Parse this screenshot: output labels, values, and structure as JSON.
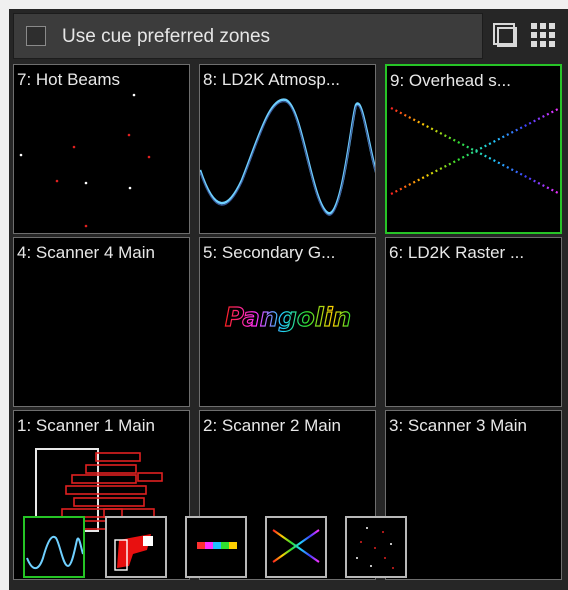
{
  "toolbar": {
    "cue_preferred_zones_label": "Use cue preferred zones",
    "cue_preferred_zones_checked": false,
    "single_view_icon": "single-view-icon",
    "grid_view_icon": "grid-view-icon"
  },
  "zones": [
    {
      "label": "7: Hot Beams",
      "selected": false
    },
    {
      "label": "8: LD2K Atmosp...",
      "selected": false
    },
    {
      "label": "9: Overhead s...",
      "selected": true
    },
    {
      "label": "4: Scanner 4 Main",
      "selected": false
    },
    {
      "label": "5: Secondary G...",
      "selected": false
    },
    {
      "label": "6: LD2K Raster ...",
      "selected": false
    },
    {
      "label": "1: Scanner 1 Main",
      "selected": false
    },
    {
      "label": "2: Scanner 2 Main",
      "selected": false
    },
    {
      "label": "3: Scanner 3 Main",
      "selected": false
    }
  ],
  "preview_text": "Pangolin",
  "thumbnails": [
    {
      "name": "sine-wave-thumb",
      "active": true
    },
    {
      "name": "red-logo-thumb",
      "active": false
    },
    {
      "name": "rainbow-text-thumb",
      "active": false
    },
    {
      "name": "cross-beams-thumb",
      "active": false
    },
    {
      "name": "dots-thumb",
      "active": false
    }
  ],
  "colors": {
    "panel": "#262626",
    "selected_border": "#27c427",
    "cell_border": "#6e6e6e"
  }
}
